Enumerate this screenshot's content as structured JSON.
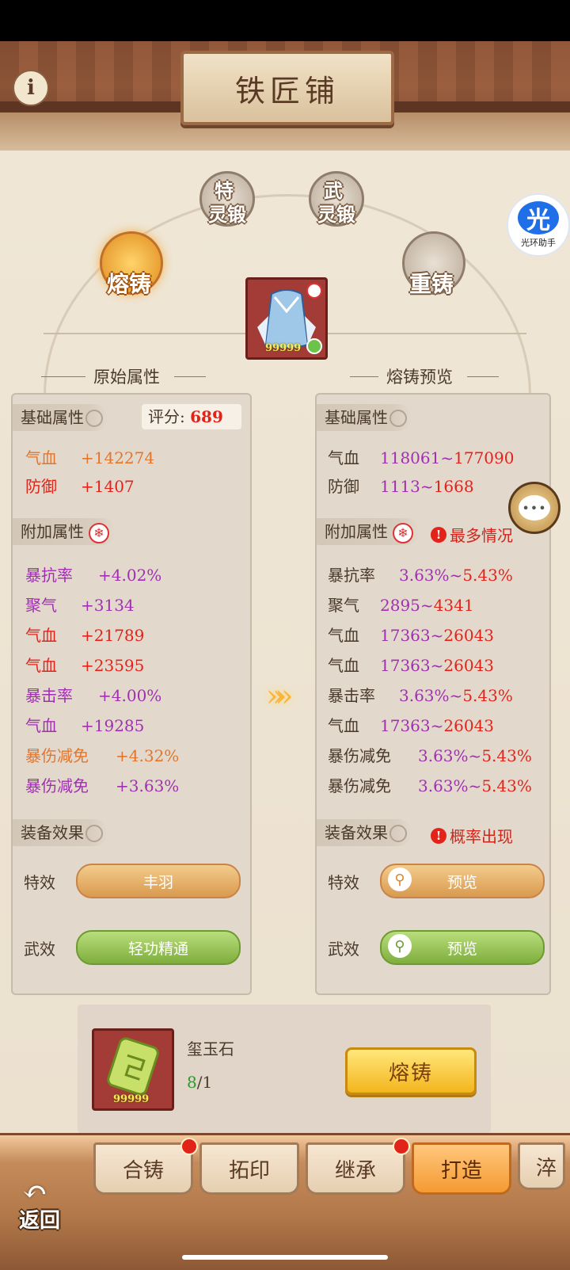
{
  "header": {
    "title": "铁匠铺",
    "info_icon": "i"
  },
  "modes": [
    {
      "char": "特",
      "label": "灵锻"
    },
    {
      "char": "武",
      "label": "灵锻"
    },
    {
      "label": "熔铸"
    },
    {
      "label": "重铸"
    }
  ],
  "assistant": {
    "glyph": "光",
    "label": "光环助手"
  },
  "item": {
    "count": "99999"
  },
  "left": {
    "heading": "原始属性",
    "base_tag": "基础属性",
    "score_label": "评分:",
    "score_value": "689",
    "base_stats": [
      {
        "name": "气血",
        "value": "+142274"
      },
      {
        "name": "防御",
        "value": "+1407"
      }
    ],
    "extra_tag": "附加属性",
    "extra_stats": [
      {
        "name": "暴抗率",
        "value": "+4.02%"
      },
      {
        "name": "聚气",
        "value": "+3134"
      },
      {
        "name": "气血",
        "value": "+21789"
      },
      {
        "name": "气血",
        "value": "+23595"
      },
      {
        "name": "暴击率",
        "value": "+4.00%"
      },
      {
        "name": "气血",
        "value": "+19285"
      },
      {
        "name": "暴伤减免",
        "value": "+4.32%"
      },
      {
        "name": "暴伤减免",
        "value": "+3.63%"
      }
    ],
    "effect_tag": "装备效果",
    "special_label": "特效",
    "special_value": "丰羽",
    "martial_label": "武效",
    "martial_value": "轻功精通"
  },
  "right": {
    "heading": "熔铸预览",
    "base_tag": "基础属性",
    "base_stats": [
      {
        "name": "气血",
        "min": "118061",
        "sep": "~",
        "max": "177090"
      },
      {
        "name": "防御",
        "min": "1113",
        "sep": "~",
        "max": "1668"
      }
    ],
    "extra_tag": "附加属性",
    "extra_warning": "最多情况",
    "extra_stats": [
      {
        "name": "暴抗率",
        "min": "3.63%",
        "sep": "~",
        "max": "5.43%"
      },
      {
        "name": "聚气",
        "min": "2895",
        "sep": "~",
        "max": "4341"
      },
      {
        "name": "气血",
        "min": "17363",
        "sep": "~",
        "max": "26043"
      },
      {
        "name": "气血",
        "min": "17363",
        "sep": "~",
        "max": "26043"
      },
      {
        "name": "暴击率",
        "min": "3.63%",
        "sep": "~",
        "max": "5.43%"
      },
      {
        "name": "气血",
        "min": "17363",
        "sep": "~",
        "max": "26043"
      },
      {
        "name": "暴伤减免",
        "min": "3.63%",
        "sep": "~",
        "max": "5.43%"
      },
      {
        "name": "暴伤减免",
        "min": "3.63%",
        "sep": "~",
        "max": "5.43%"
      }
    ],
    "effect_tag": "装备效果",
    "effect_warning": "概率出现",
    "special_label": "特效",
    "special_value": "预览",
    "martial_label": "武效",
    "martial_value": "预览"
  },
  "material": {
    "name": "玺玉石",
    "have": "8",
    "need": "/1",
    "count": "99999",
    "button": "熔铸"
  },
  "tabs": [
    {
      "label": "合铸",
      "badge": true
    },
    {
      "label": "拓印",
      "badge": false
    },
    {
      "label": "继承",
      "badge": true
    },
    {
      "label": "打造",
      "badge": false,
      "active": true
    },
    {
      "label": "淬",
      "badge": false
    }
  ],
  "back_label": "返回",
  "colors": {
    "accent_gold": "#f3b51e",
    "attr_red": "#e2231a",
    "attr_purple": "#a030b0",
    "attr_orange": "#e2762d"
  }
}
